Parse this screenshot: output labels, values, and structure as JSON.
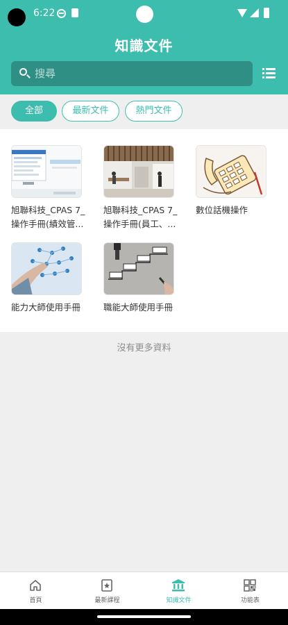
{
  "status": {
    "time": "6:22"
  },
  "header": {
    "title": "知識文件"
  },
  "search": {
    "placeholder": "搜尋"
  },
  "filters": [
    {
      "label": "全部",
      "active": true
    },
    {
      "label": "最新文件",
      "active": false
    },
    {
      "label": "熱門文件",
      "active": false
    }
  ],
  "documents": [
    {
      "title": "旭聯科技_CPAS 7_操作手冊(績效管...",
      "thumb": "cpas-manual-screenshot"
    },
    {
      "title": "旭聯科技_CPAS 7_操作手冊(員工、...",
      "thumb": "office-lobby-photo"
    },
    {
      "title": "數位話機操作",
      "thumb": "desk-phone-illustration"
    },
    {
      "title": "能力大師使用手冊",
      "thumb": "network-people-hand"
    },
    {
      "title": "職能大師使用手冊",
      "thumb": "success-steps-drawing"
    }
  ],
  "list_end": "沒有更多資料",
  "bottom_nav": [
    {
      "label": "首頁",
      "icon": "home-icon",
      "active": false
    },
    {
      "label": "最新課程",
      "icon": "course-icon",
      "active": false
    },
    {
      "label": "知識文件",
      "icon": "library-icon",
      "active": true
    },
    {
      "label": "功能表",
      "icon": "grid-menu-icon",
      "active": false
    }
  ],
  "colors": {
    "primary": "#3dbdae",
    "search_bg": "#2f8f84",
    "page_bg": "#efefef"
  }
}
